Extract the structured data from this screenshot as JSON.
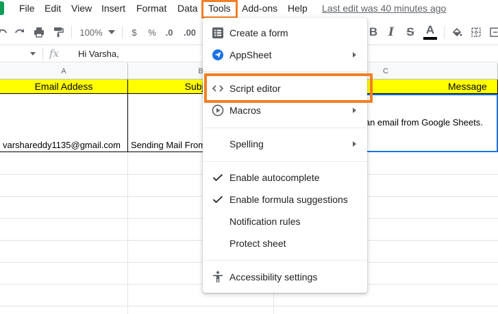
{
  "menubar": {
    "items": [
      "File",
      "Edit",
      "View",
      "Insert",
      "Format",
      "Data",
      "Tools",
      "Add-ons",
      "Help"
    ],
    "last_edit": "Last edit was 40 minutes ago"
  },
  "toolbar": {
    "zoom": "100%",
    "currency": "$",
    "percent": "%",
    "dec_decrease": ".0",
    "dec_increase": ".00",
    "bold": "B",
    "italic": "I",
    "strike": "S",
    "text_color": "A"
  },
  "formula_bar": {
    "fx": "fx",
    "value": "Hi Varsha,"
  },
  "sheet": {
    "columns": [
      "A",
      "B",
      "C"
    ],
    "header_row": [
      "Email Addess",
      "Subject",
      "Message"
    ],
    "data_row": [
      "varshareddy1135@gmail.com",
      "Sending Mail From",
      "d an email from Google Sheets."
    ]
  },
  "menu": {
    "items": [
      {
        "label": "Create a form",
        "icon": "form-icon",
        "submenu": false
      },
      {
        "label": "AppSheet",
        "icon": "appsheet-icon",
        "submenu": true
      },
      {
        "label": "Script editor",
        "icon": "code-icon",
        "submenu": false
      },
      {
        "label": "Macros",
        "icon": "macros-icon",
        "submenu": true
      },
      {
        "label": "Spelling",
        "icon": "",
        "submenu": true
      },
      {
        "label": "Enable autocomplete",
        "icon": "check-icon",
        "submenu": false
      },
      {
        "label": "Enable formula suggestions",
        "icon": "check-icon",
        "submenu": false
      },
      {
        "label": "Notification rules",
        "icon": "",
        "submenu": false
      },
      {
        "label": "Protect sheet",
        "icon": "",
        "submenu": false
      },
      {
        "label": "Accessibility settings",
        "icon": "accessibility-icon",
        "submenu": false
      }
    ]
  },
  "colors": {
    "highlight": "#f07f26",
    "header_fill": "#ffff00",
    "brand": "#0f9d58",
    "selection": "#1a73e8"
  }
}
